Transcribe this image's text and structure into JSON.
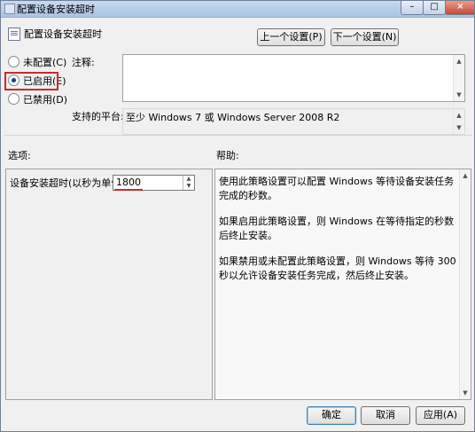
{
  "window": {
    "title": "配置设备安装超时",
    "buttons": {
      "minimize": "–",
      "maximize": "□",
      "close": "×"
    }
  },
  "header": {
    "title": "配置设备安装超时",
    "prev_label": "上一个设置(P)",
    "next_label": "下一个设置(N)"
  },
  "options": [
    {
      "label": "未配置(C)",
      "selected": false
    },
    {
      "label": "已启用(E)",
      "selected": true
    },
    {
      "label": "已禁用(D)",
      "selected": false
    }
  ],
  "comment": {
    "label": "注释:",
    "value": ""
  },
  "platform": {
    "label": "支持的平台:",
    "value": "至少 Windows 7 或 Windows Server 2008 R2"
  },
  "sections": {
    "options_label": "选项:",
    "help_label": "帮助:"
  },
  "timeout": {
    "label": "设备安装超时(以秒为单位)",
    "value": "1800"
  },
  "help": {
    "paragraphs": [
      "使用此策略设置可以配置 Windows 等待设备安装任务完成的秒数。",
      "如果启用此策略设置，则 Windows 在等待指定的秒数后终止安装。",
      "如果禁用或未配置此策略设置，则 Windows 等待 300 秒以允许设备安装任务完成，然后终止安装。"
    ]
  },
  "footer": {
    "ok_label": "确定",
    "cancel_label": "取消",
    "apply_label": "应用(A)"
  },
  "colors": {
    "highlight": "#c82c2c",
    "window_bg": "#f0f0f0"
  }
}
